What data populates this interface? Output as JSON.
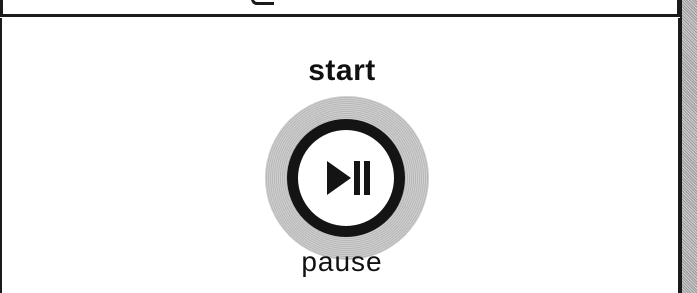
{
  "device": {
    "top_label": "start",
    "bottom_label": "pause",
    "button_icon": "play-pause-icon"
  },
  "colors": {
    "ink": "#141414",
    "halo": "#c4c4c4",
    "background": "#ffffff"
  }
}
